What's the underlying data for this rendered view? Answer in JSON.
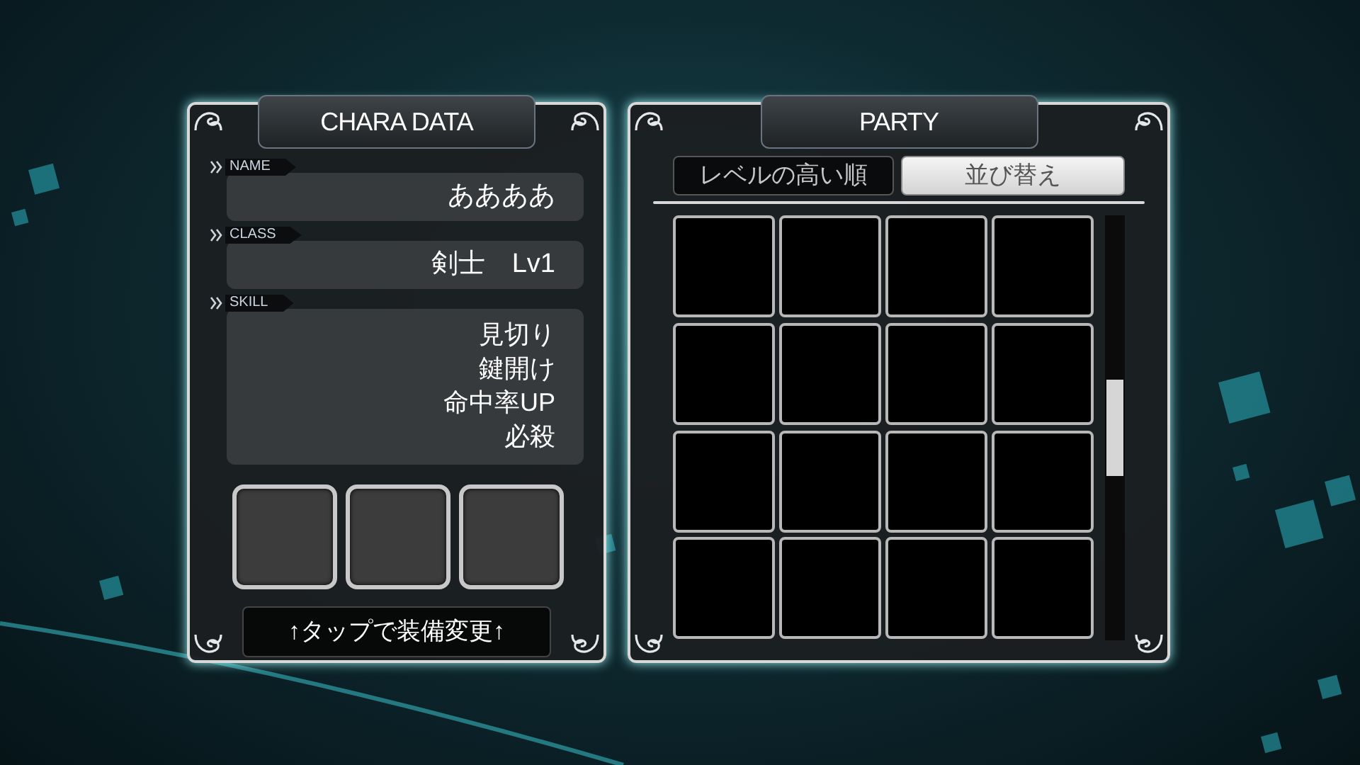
{
  "chara_panel": {
    "title": "CHARA DATA",
    "fields": [
      {
        "label": "NAME",
        "kind": "single",
        "value": "ああああ"
      },
      {
        "label": "CLASS",
        "kind": "single",
        "value": "剣士　Lv1"
      },
      {
        "label": "SKILL",
        "kind": "list",
        "values": [
          "見切り",
          "鍵開け",
          "命中率UP",
          "必殺"
        ]
      }
    ],
    "equip_hint": "↑タップで装備変更↑"
  },
  "party_panel": {
    "title": "PARTY",
    "sort_order": "レベルの高い順",
    "sort_button": "並び替え"
  }
}
